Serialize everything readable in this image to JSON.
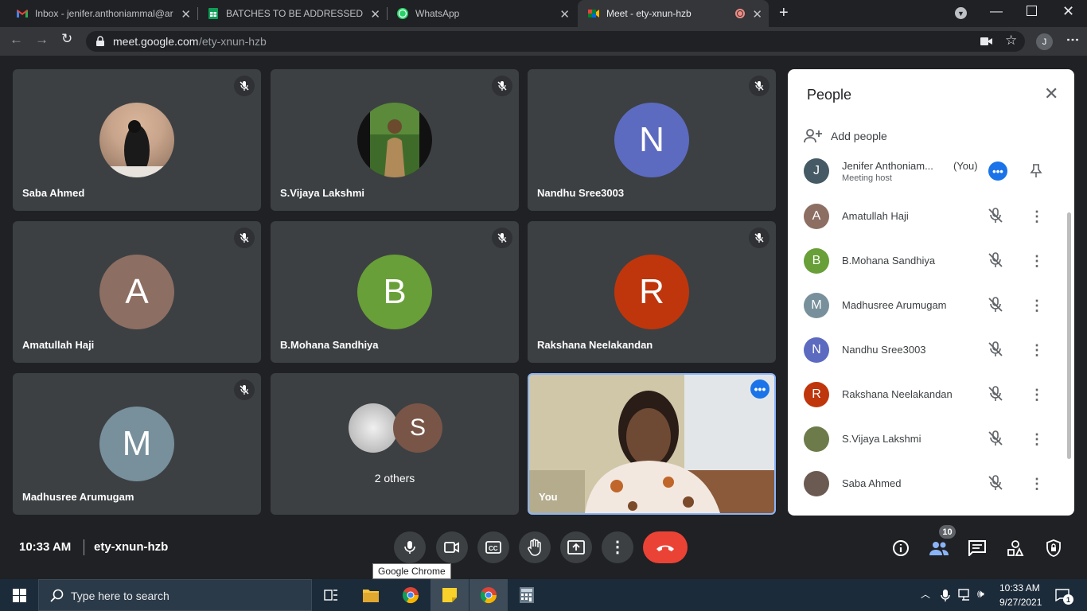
{
  "browser": {
    "tabs": [
      {
        "title": "Inbox - jenifer.anthoniammal@ar",
        "icon": "gmail-icon"
      },
      {
        "title": "BATCHES TO BE ADDRESSED ON",
        "icon": "sheets-icon"
      },
      {
        "title": "WhatsApp",
        "icon": "whatsapp-icon"
      },
      {
        "title": "Meet - ety-xnun-hzb",
        "icon": "meet-icon",
        "active": true
      }
    ],
    "url_host": "meet.google.com",
    "url_path": "/ety-xnun-hzb",
    "profile_initial": "J"
  },
  "tiles": [
    {
      "name": "Saba Ahmed",
      "kind": "photo",
      "muted": true
    },
    {
      "name": "S.Vijaya Lakshmi",
      "kind": "photo",
      "muted": true
    },
    {
      "name": "Nandhu Sree3003",
      "initial": "N",
      "color": "#5c6bc0",
      "muted": true
    },
    {
      "name": "Amatullah Haji",
      "initial": "A",
      "color": "#8d6e63",
      "muted": true
    },
    {
      "name": "B.Mohana Sandhiya",
      "initial": "B",
      "color": "#689f38",
      "muted": true
    },
    {
      "name": "Rakshana Neelakandan",
      "initial": "R",
      "color": "#bf360c",
      "muted": true
    },
    {
      "name": "Madhusree Arumugam",
      "initial": "M",
      "color": "#78909c",
      "muted": true
    },
    {
      "name": "2 others",
      "second_initial": "S",
      "second_color": "#795548"
    },
    {
      "name": "You",
      "kind": "self-video"
    }
  ],
  "people_panel": {
    "title": "People",
    "add_label": "Add people",
    "host": {
      "name": "Jenifer Anthoniam...",
      "you": "(You)",
      "role": "Meeting host",
      "initial": "J",
      "color": "#455a64"
    },
    "participants": [
      {
        "name": "Amatullah Haji",
        "initial": "A",
        "color": "#8d6e63"
      },
      {
        "name": "B.Mohana Sandhiya",
        "initial": "B",
        "color": "#689f38"
      },
      {
        "name": "Madhusree Arumugam",
        "initial": "M",
        "color": "#78909c"
      },
      {
        "name": "Nandhu Sree3003",
        "initial": "N",
        "color": "#5c6bc0"
      },
      {
        "name": "Rakshana Neelakandan",
        "initial": "R",
        "color": "#bf360c"
      },
      {
        "name": "S.Vijaya Lakshmi",
        "initial": "",
        "color": "#6d7b4a"
      },
      {
        "name": "Saba Ahmed",
        "initial": "",
        "color": "#6b5a52"
      }
    ]
  },
  "meeting_bar": {
    "time": "10:33 AM",
    "code": "ety-xnun-hzb",
    "tooltip": "Google Chrome",
    "people_count": "10",
    "end_color": "#ea4335"
  },
  "taskbar": {
    "search_placeholder": "Type here to search",
    "clock_time": "10:33 AM",
    "clock_date": "9/27/2021",
    "notification_count": "1"
  }
}
